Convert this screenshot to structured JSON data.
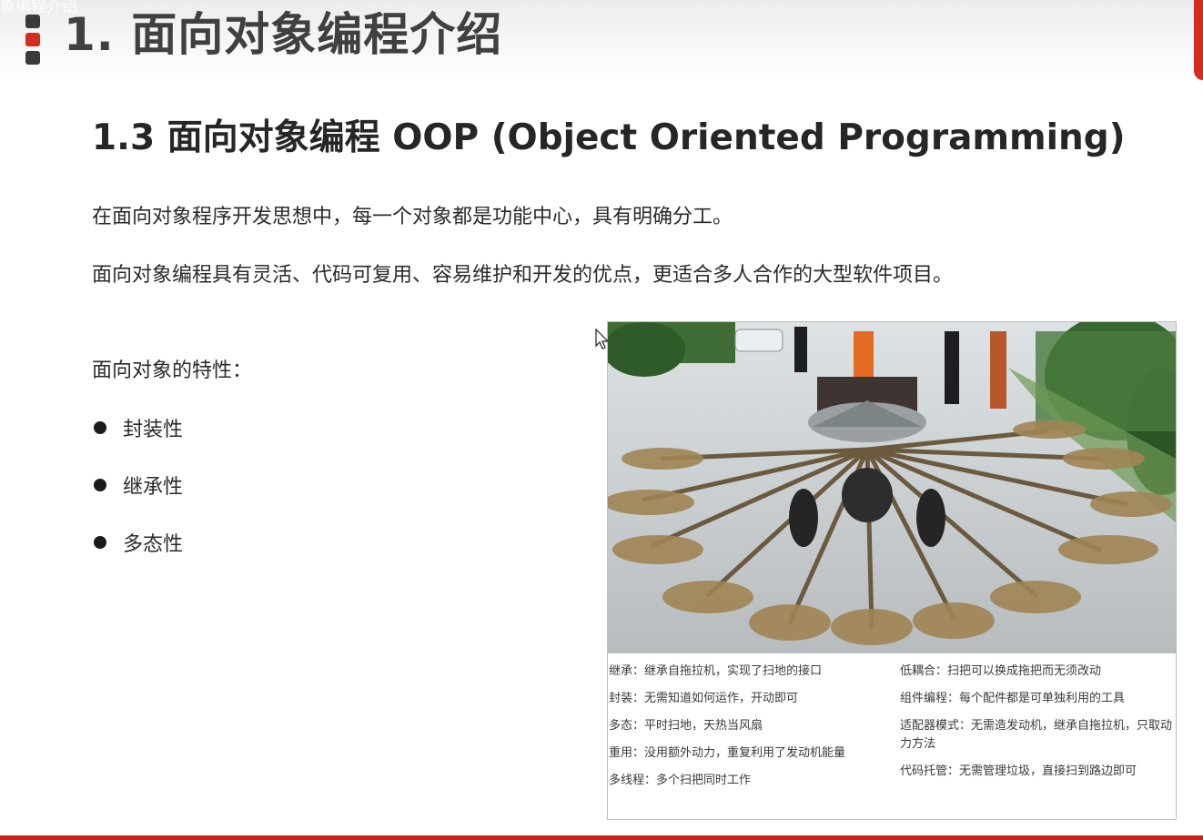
{
  "window": {
    "tab_title": "象编程介绍"
  },
  "header": {
    "title": "1. 面向对象编程介绍"
  },
  "section": {
    "title": "1.3 面向对象编程 OOP (Object Oriented Programming)"
  },
  "paragraphs": [
    "在面向对象程序开发思想中，每一个对象都是功能中心，具有明确分工。",
    "面向对象编程具有灵活、代码可复用、容易维护和开发的优点，更适合多人合作的大型软件项目。"
  ],
  "features": {
    "heading": "面向对象的特性：",
    "items": [
      "封装性",
      "继承性",
      "多态性"
    ]
  },
  "figure": {
    "captions_left": [
      "继承：继承自拖拉机，实现了扫地的接口",
      "封装：无需知道如何运作，开动即可",
      "多态：平时扫地，天热当风扇",
      "重用：没用额外动力，重复利用了发动机能量",
      "多线程：多个扫把同时工作"
    ],
    "captions_right": [
      "低耦合：扫把可以换成拖把而无须改动",
      "组件编程：每个配件都是可单独利用的工具",
      "适配器模式：无需造发动机，继承自拖拉机，只取动力方法",
      "代码托管：无需管理垃圾，直接扫到路边即可"
    ]
  },
  "colors": {
    "accent": "#d42c1f",
    "title": "#404040",
    "text": "#2a2a2a"
  },
  "icons": [
    "menu-bars-icon",
    "cursor-arrow-icon",
    "bullet-icon"
  ]
}
